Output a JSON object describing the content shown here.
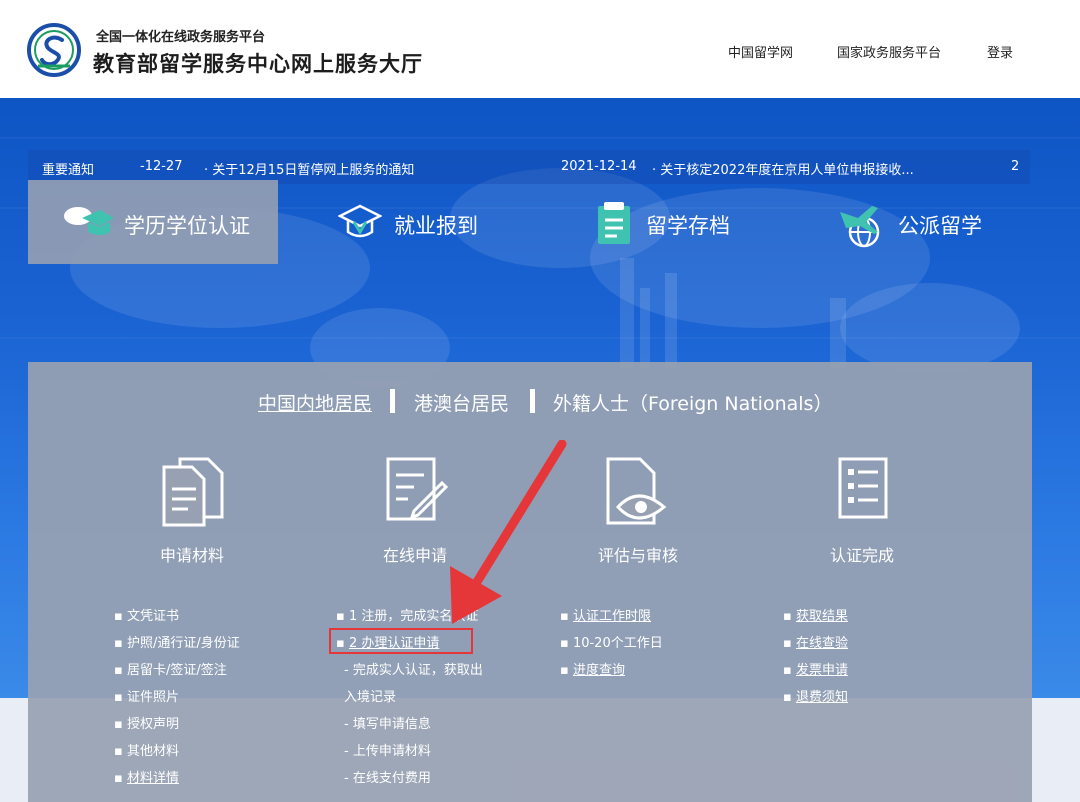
{
  "header": {
    "subtitle": "全国一体化在线政务服务平台",
    "title": "教育部留学服务中心网上服务大厅",
    "nav": [
      "中国留学网",
      "国家政务服务平台",
      "登录"
    ]
  },
  "notice": {
    "label": "重要通知",
    "items": [
      {
        "date": "-12-27",
        "text": "· 关于12月15日暂停网上服务的通知"
      },
      {
        "date": "2021-12-14",
        "text": "· 关于核定2022年度在京用人单位申报接收..."
      }
    ],
    "overflow": "2"
  },
  "tabs": [
    "学历学位认证",
    "就业报到",
    "留学存档",
    "公派留学"
  ],
  "subtabs": [
    "中国内地居民",
    "港澳台居民",
    "外籍人士（Foreign Nationals）"
  ],
  "steps": [
    {
      "title": "申请材料",
      "items": [
        "文凭证书",
        "护照/通行证/身份证",
        "居留卡/签证/签注",
        "证件照片",
        "授权声明",
        "其他材料",
        "材料详情"
      ]
    },
    {
      "title": "在线申请",
      "items": [
        "1 注册，完成实名认证",
        "2 办理认证申请",
        "- 完成实人认证，获取出",
        "入境记录",
        "- 填写申请信息",
        "- 上传申请材料",
        "- 在线支付费用"
      ]
    },
    {
      "title": "评估与审核",
      "items": [
        "认证工作时限",
        "10-20个工作日",
        "进度查询"
      ]
    },
    {
      "title": "认证完成",
      "items": [
        "获取结果",
        "在线查验",
        "发票申请",
        "退费须知"
      ]
    }
  ],
  "colors": {
    "hero": "#1a62d2",
    "panel": "#98a1b2",
    "highlight": "#e5363a"
  }
}
